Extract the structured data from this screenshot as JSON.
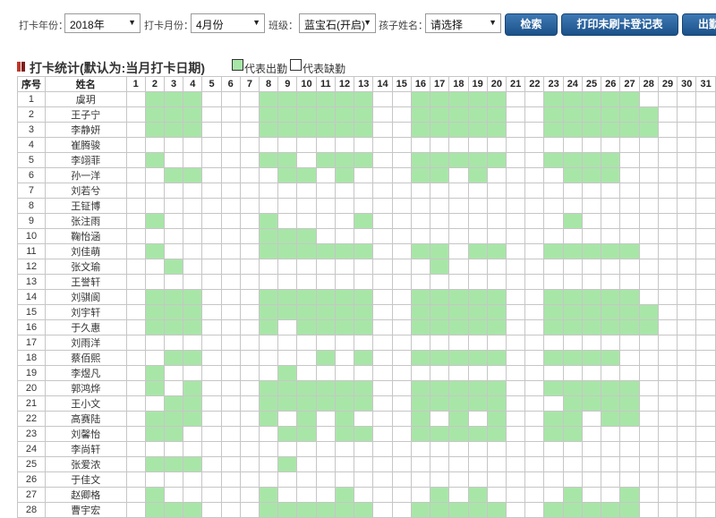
{
  "filters": {
    "year_label": "打卡年份：",
    "year_value": "2018年",
    "month_label": "打卡月份：",
    "month_value": "4月份",
    "class_label": "班级：",
    "class_value": "蓝宝石(开启)",
    "child_label": "孩子姓名：",
    "child_value": "请选择",
    "search_button": "检索",
    "print_button": "打印未刷卡登记表",
    "export_button": "出勤"
  },
  "section": {
    "title": "打卡统计(默认为:当月打卡日期)",
    "legend_present": "代表出勤",
    "legend_absent": "代表缺勤"
  },
  "colors": {
    "present": "#a8e6a8",
    "absent": "#ffffff",
    "button": "#1c5189"
  },
  "table": {
    "col_seq": "序号",
    "col_name": "姓名",
    "days": [
      "1",
      "2",
      "3",
      "4",
      "5",
      "6",
      "7",
      "8",
      "9",
      "10",
      "11",
      "12",
      "13",
      "14",
      "15",
      "16",
      "17",
      "18",
      "19",
      "20",
      "21",
      "22",
      "23",
      "24",
      "25",
      "26",
      "27",
      "28",
      "29",
      "30",
      "31"
    ],
    "rows": [
      {
        "seq": "1",
        "name": "虞玥",
        "present": [
          2,
          3,
          4,
          8,
          9,
          10,
          11,
          12,
          13,
          16,
          17,
          18,
          19,
          20,
          23,
          24,
          25,
          26,
          27
        ]
      },
      {
        "seq": "2",
        "name": "王子宁",
        "present": [
          2,
          3,
          4,
          8,
          9,
          10,
          11,
          12,
          13,
          16,
          17,
          18,
          19,
          20,
          23,
          24,
          25,
          26,
          27,
          28
        ]
      },
      {
        "seq": "3",
        "name": "李静妍",
        "present": [
          2,
          3,
          4,
          8,
          9,
          10,
          11,
          12,
          13,
          16,
          17,
          18,
          19,
          20,
          23,
          24,
          25,
          26,
          27,
          28
        ]
      },
      {
        "seq": "4",
        "name": "崔腾骏",
        "present": []
      },
      {
        "seq": "5",
        "name": "李翊菲",
        "present": [
          2,
          8,
          9,
          11,
          12,
          13,
          16,
          17,
          18,
          19,
          20,
          23,
          24,
          25,
          26
        ]
      },
      {
        "seq": "6",
        "name": "孙一洋",
        "present": [
          3,
          4,
          9,
          10,
          12,
          16,
          17,
          19,
          24,
          25,
          26
        ]
      },
      {
        "seq": "7",
        "name": "刘若兮",
        "present": []
      },
      {
        "seq": "8",
        "name": "王钲博",
        "present": []
      },
      {
        "seq": "9",
        "name": "张注雨",
        "present": [
          2,
          8,
          13,
          24
        ]
      },
      {
        "seq": "10",
        "name": "鞠怡涵",
        "present": [
          8,
          9,
          10
        ]
      },
      {
        "seq": "11",
        "name": "刘佳萌",
        "present": [
          2,
          8,
          9,
          10,
          11,
          12,
          13,
          16,
          17,
          19,
          20,
          23,
          24,
          25,
          26,
          27
        ]
      },
      {
        "seq": "12",
        "name": "张文瑜",
        "present": [
          3,
          17
        ]
      },
      {
        "seq": "13",
        "name": "王誉轩",
        "present": []
      },
      {
        "seq": "14",
        "name": "刘骐阆",
        "present": [
          2,
          3,
          4,
          8,
          9,
          10,
          11,
          12,
          13,
          16,
          17,
          18,
          19,
          20,
          23,
          24,
          25,
          26,
          27
        ]
      },
      {
        "seq": "15",
        "name": "刘宇轩",
        "present": [
          2,
          3,
          4,
          8,
          9,
          10,
          11,
          12,
          13,
          16,
          17,
          18,
          19,
          20,
          23,
          24,
          25,
          26,
          27,
          28
        ]
      },
      {
        "seq": "16",
        "name": "于久惠",
        "present": [
          2,
          3,
          4,
          8,
          10,
          11,
          12,
          13,
          16,
          17,
          18,
          19,
          20,
          23,
          24,
          25,
          26,
          27,
          28
        ]
      },
      {
        "seq": "17",
        "name": "刘雨洋",
        "present": []
      },
      {
        "seq": "18",
        "name": "蔡佰熙",
        "present": [
          3,
          4,
          11,
          13,
          16,
          17,
          18,
          19,
          20,
          23,
          24,
          25,
          26
        ]
      },
      {
        "seq": "19",
        "name": "李煜凡",
        "present": [
          2,
          9
        ]
      },
      {
        "seq": "20",
        "name": "郭鸿烨",
        "present": [
          2,
          4,
          8,
          9,
          10,
          11,
          12,
          13,
          16,
          17,
          18,
          19,
          20,
          23,
          24,
          25,
          26,
          27
        ]
      },
      {
        "seq": "21",
        "name": "王小文",
        "present": [
          3,
          4,
          8,
          9,
          10,
          11,
          12,
          13,
          16,
          17,
          18,
          19,
          20,
          24,
          25,
          26,
          27
        ]
      },
      {
        "seq": "22",
        "name": "高赛陆",
        "present": [
          2,
          3,
          4,
          8,
          10,
          12,
          16,
          18,
          20,
          23,
          24,
          26,
          27
        ]
      },
      {
        "seq": "23",
        "name": "刘馨怡",
        "present": [
          2,
          3,
          9,
          10,
          12,
          13,
          16,
          17,
          18,
          19,
          20,
          23,
          24
        ]
      },
      {
        "seq": "24",
        "name": "李尚轩",
        "present": []
      },
      {
        "seq": "25",
        "name": "张爱浓",
        "present": [
          2,
          3,
          4,
          9
        ]
      },
      {
        "seq": "26",
        "name": "于佳文",
        "present": []
      },
      {
        "seq": "27",
        "name": "赵卿格",
        "present": [
          2,
          8,
          12,
          17,
          19,
          24,
          27
        ]
      },
      {
        "seq": "28",
        "name": "曹宇宏",
        "present": [
          2,
          3,
          4,
          8,
          9,
          10,
          11,
          12,
          13,
          16,
          17,
          18,
          19,
          20,
          23,
          24,
          25,
          26,
          27
        ]
      }
    ]
  }
}
